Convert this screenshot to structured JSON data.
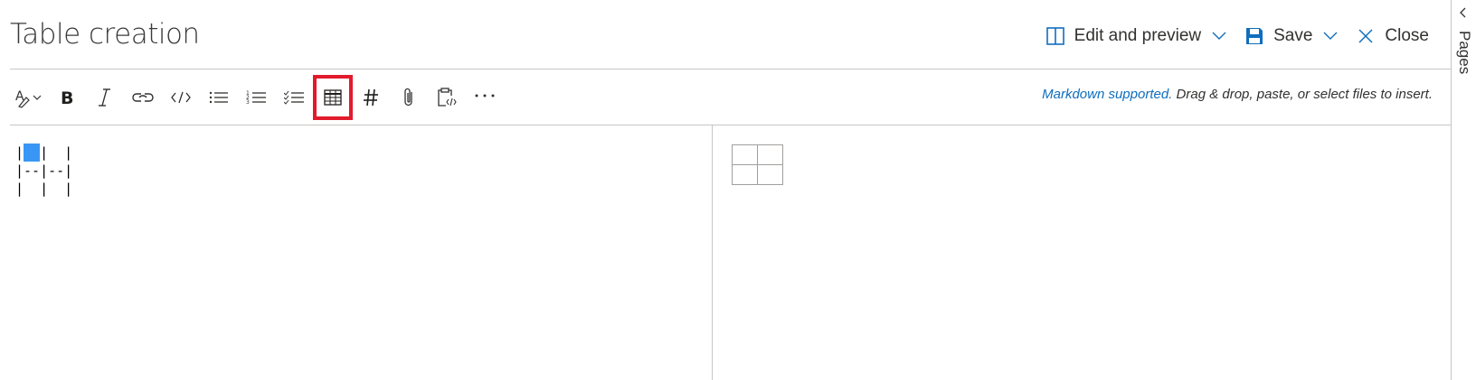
{
  "page": {
    "title": "Table creation"
  },
  "header": {
    "edit_preview_label": "Edit and preview",
    "save_label": "Save",
    "close_label": "Close"
  },
  "toolbar": {
    "items": [
      {
        "name": "text-format",
        "icon": "text-highlight-icon"
      },
      {
        "name": "bold",
        "icon": "bold-icon"
      },
      {
        "name": "italic",
        "icon": "italic-icon"
      },
      {
        "name": "link",
        "icon": "link-icon"
      },
      {
        "name": "code",
        "icon": "code-icon"
      },
      {
        "name": "bulleted-list",
        "icon": "bulleted-list-icon"
      },
      {
        "name": "numbered-list",
        "icon": "numbered-list-icon"
      },
      {
        "name": "task-list",
        "icon": "task-list-icon"
      },
      {
        "name": "table",
        "icon": "table-icon",
        "highlighted": true
      },
      {
        "name": "heading",
        "icon": "hashtag-icon"
      },
      {
        "name": "attach",
        "icon": "paperclip-icon"
      },
      {
        "name": "paste-code",
        "icon": "clipboard-code-icon"
      },
      {
        "name": "more",
        "icon": "more-icon"
      }
    ],
    "hint_link": "Markdown supported.",
    "hint_text": " Drag & drop, paste, or select files to insert."
  },
  "editor": {
    "lines": [
      "|  |  |",
      "|--|--|",
      "|  |  |"
    ]
  },
  "preview": {
    "table_rows": 2,
    "table_cols": 2
  },
  "side_rail": {
    "label": "Pages"
  },
  "colors": {
    "accent": "#106ebe",
    "highlight_box": "#e21b2c",
    "cursor": "#3a96f5",
    "divider": "#c8c6c4"
  }
}
